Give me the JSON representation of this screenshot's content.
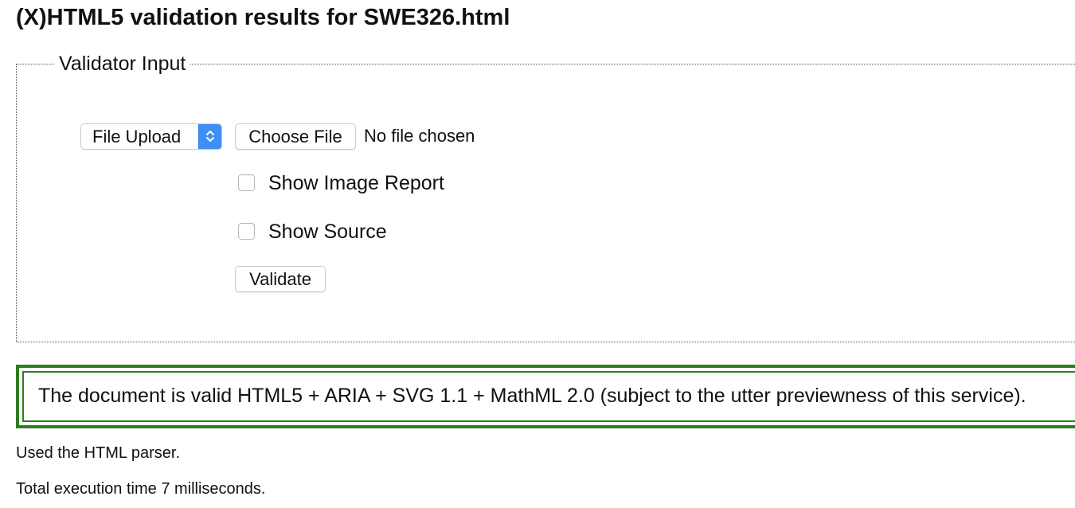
{
  "page": {
    "title": "(X)HTML5 validation results for SWE326.html"
  },
  "validator_input": {
    "legend": "Validator Input",
    "input_mode": {
      "selected": "File Upload",
      "icon": "updown-chevron-icon"
    },
    "file": {
      "button_label": "Choose File",
      "status": "No file chosen"
    },
    "options": [
      {
        "label": "Show Image Report",
        "checked": false
      },
      {
        "label": "Show Source",
        "checked": false
      }
    ],
    "validate_label": "Validate"
  },
  "result": {
    "message": "The document is valid HTML5 + ARIA + SVG 1.1 + MathML 2.0 (subject to the utter previewness of this service).",
    "border_color": "#2c7d1f"
  },
  "details": {
    "parser": "Used the HTML parser.",
    "execution_time": "Total execution time 7 milliseconds."
  },
  "colors": {
    "select_accent": "#3d8ef5",
    "result_border": "#2c7d1f"
  }
}
